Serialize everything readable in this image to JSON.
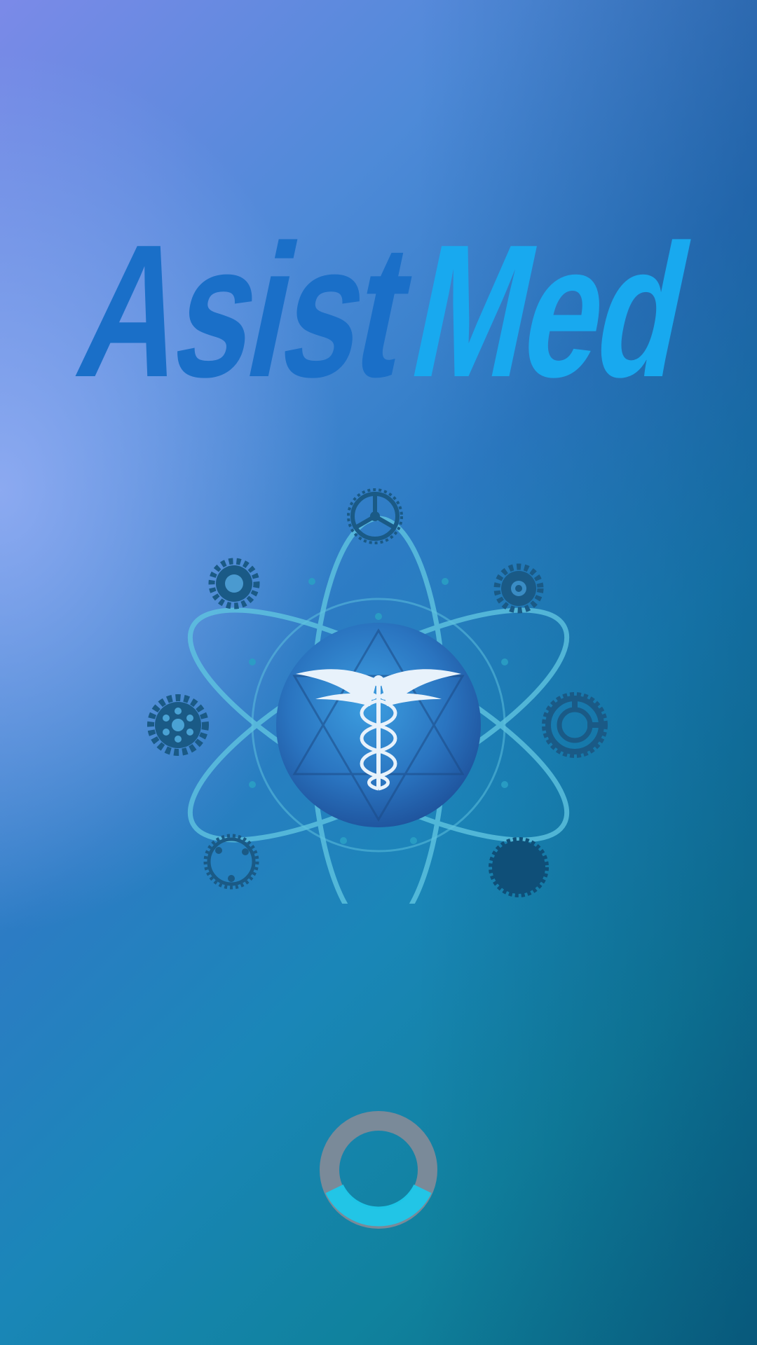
{
  "app": {
    "name_part1": "Asist",
    "name_part2": "Med"
  },
  "emblem": {
    "icon": "caduceus-icon",
    "orbit_icons": [
      "gear-icon",
      "gear-icon",
      "gear-icon",
      "gear-icon",
      "gear-icon",
      "gear-icon",
      "gear-icon"
    ]
  },
  "loader": {
    "icon": "spinner-icon"
  },
  "colors": {
    "logo_dark": "#1a6fc8",
    "logo_light": "#18a9ef",
    "gear": "#1a5a86",
    "orbit": "#5fc4e0",
    "spinner_track": "#7a8a99",
    "spinner_accent": "#1ec8ea"
  }
}
